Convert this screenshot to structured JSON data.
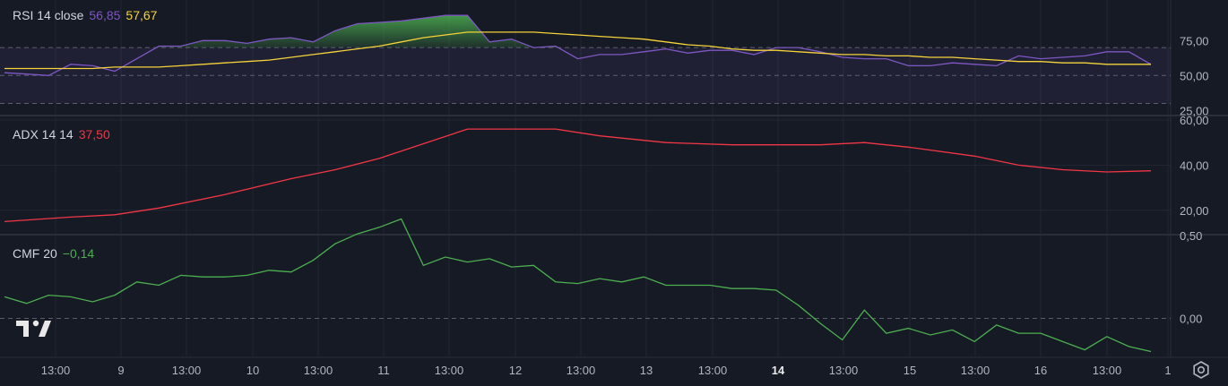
{
  "colors": {
    "background": "#161a25",
    "rsi_line": "#7e57c2",
    "rsi_ma": "#f5d33a",
    "adx_line": "#f23645",
    "cmf_line": "#4caf50",
    "text": "#d1d4dc",
    "axis_text": "#b2b5be"
  },
  "panes": {
    "rsi": {
      "name": "RSI 14 close",
      "value1": "56,85",
      "value2": "57,67"
    },
    "adx": {
      "name": "ADX 14 14",
      "value1": "37,50"
    },
    "cmf": {
      "name": "CMF 20",
      "value1": "−0,14"
    }
  },
  "x_axis_labels": [
    "13:00",
    "9",
    "13:00",
    "10",
    "13:00",
    "11",
    "13:00",
    "12",
    "13:00",
    "13",
    "13:00",
    "14",
    "13:00",
    "15",
    "13:00",
    "16",
    "13:00",
    "1"
  ],
  "bold_x_label": "14",
  "icons": {
    "logo": "tradingview-logo-icon",
    "settings": "settings-gear-icon"
  },
  "chart_data": [
    {
      "type": "line",
      "title": "RSI 14 close",
      "y_tick_labels": [
        "75,00",
        "50,00",
        "25,00"
      ],
      "ylim": [
        22,
        104
      ],
      "bands": [
        70,
        50,
        30
      ],
      "x": [
        0,
        1,
        2,
        3,
        4,
        5,
        6,
        7,
        8,
        9,
        10,
        11,
        12,
        13,
        14,
        15,
        16,
        17,
        18,
        19,
        20,
        21,
        22,
        23,
        24,
        25,
        26,
        27,
        28,
        29,
        30,
        31,
        32,
        33,
        34,
        35,
        36,
        37,
        38,
        39,
        40,
        41,
        42,
        43,
        44,
        45,
        46,
        47,
        48,
        49,
        50,
        51,
        52
      ],
      "series": [
        {
          "name": "RSI",
          "values": [
            52,
            51,
            50,
            58,
            57,
            53,
            62,
            71,
            71,
            75,
            75,
            73,
            76,
            77,
            74,
            82,
            87,
            88,
            89,
            91,
            93,
            93,
            74,
            76,
            70,
            71,
            62,
            65,
            65,
            67,
            69,
            66,
            68,
            68,
            65,
            70,
            70,
            67,
            63,
            62,
            62,
            57,
            57,
            59,
            58,
            57,
            64,
            62,
            63,
            64,
            67,
            67,
            58
          ]
        },
        {
          "name": "MA",
          "values": [
            55,
            55,
            55,
            55,
            55,
            56,
            56,
            56,
            57,
            58,
            59,
            60,
            61,
            63,
            65,
            67,
            69,
            71,
            74,
            77,
            79,
            81,
            81,
            81,
            81,
            80,
            79,
            78,
            77,
            76,
            74,
            72,
            71,
            69,
            68,
            68,
            67,
            66,
            65,
            65,
            64,
            64,
            63,
            63,
            62,
            61,
            60,
            60,
            59,
            59,
            58,
            58,
            58
          ]
        }
      ]
    },
    {
      "type": "line",
      "title": "ADX 14 14",
      "y_tick_labels": [
        "60,00",
        "40,00",
        "20,00"
      ],
      "ylim": [
        9.6,
        61.6
      ],
      "x": [
        0,
        3,
        5,
        7,
        10,
        13,
        15,
        17,
        21,
        23,
        25,
        27,
        30,
        33,
        35,
        37,
        39,
        41,
        44,
        46,
        48,
        50,
        52
      ],
      "series": [
        {
          "name": "ADX",
          "values": [
            15,
            17,
            18,
            21,
            27,
            34,
            38,
            43,
            56,
            56,
            56,
            53,
            50,
            49,
            49,
            49,
            50,
            48,
            44,
            40,
            38,
            37,
            37.5
          ]
        }
      ]
    },
    {
      "type": "line",
      "title": "CMF 20",
      "y_tick_labels": [
        "0,50",
        "0,00"
      ],
      "ylim": [
        -0.23,
        0.5
      ],
      "x": [
        0,
        1,
        2,
        3,
        4,
        5,
        6,
        7,
        8,
        9,
        10,
        11,
        12,
        13,
        14,
        15,
        16,
        17,
        18,
        19,
        20,
        21,
        22,
        23,
        24,
        25,
        26,
        27,
        28,
        29,
        30,
        31,
        32,
        33,
        34,
        35,
        36,
        37,
        38,
        39,
        40,
        41,
        42,
        43,
        44,
        45,
        46,
        47,
        48,
        49,
        50,
        51,
        52
      ],
      "series": [
        {
          "name": "CMF",
          "values": [
            0.13,
            0.09,
            0.14,
            0.13,
            0.1,
            0.14,
            0.22,
            0.2,
            0.26,
            0.25,
            0.25,
            0.26,
            0.29,
            0.28,
            0.35,
            0.45,
            0.51,
            0.55,
            0.6,
            0.32,
            0.37,
            0.34,
            0.36,
            0.31,
            0.32,
            0.22,
            0.21,
            0.24,
            0.22,
            0.25,
            0.2,
            0.2,
            0.2,
            0.18,
            0.18,
            0.17,
            0.08,
            -0.03,
            -0.13,
            0.05,
            -0.09,
            -0.06,
            -0.1,
            -0.07,
            -0.14,
            -0.04,
            -0.09,
            -0.09,
            -0.14,
            -0.19,
            -0.11,
            -0.17,
            -0.2
          ]
        }
      ]
    }
  ]
}
